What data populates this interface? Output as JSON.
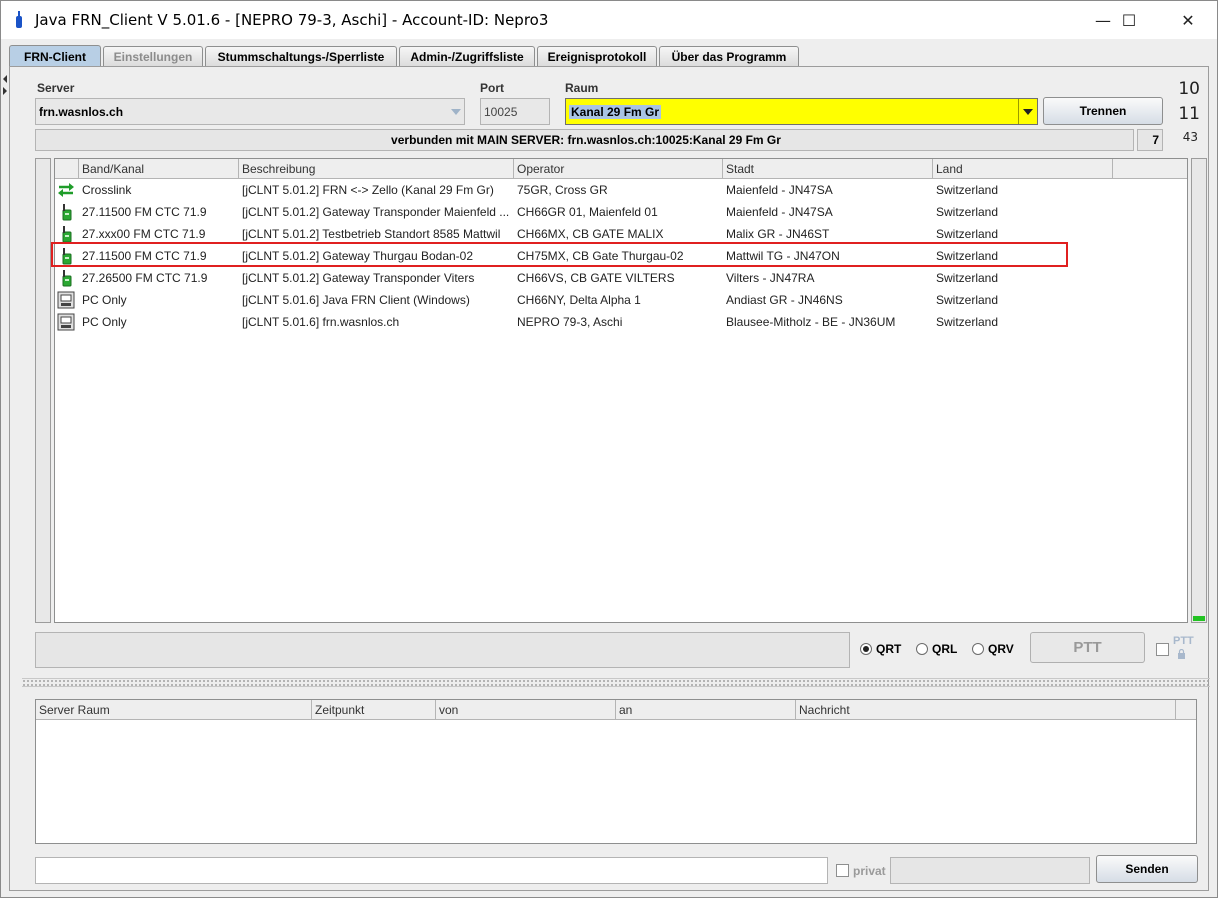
{
  "window": {
    "title": "Java FRN_Client V 5.01.6 - [NEPRO 79-3, Aschi] - Account-ID: Nepro3",
    "minimize": "—",
    "maximize": "☐",
    "close": "✕"
  },
  "tabs": [
    {
      "label": "FRN-Client"
    },
    {
      "label": "Einstellungen"
    },
    {
      "label": "Stummschaltungs-/Sperrliste"
    },
    {
      "label": "Admin-/Zugriffsliste"
    },
    {
      "label": "Ereignisprotokoll"
    },
    {
      "label": "Über das Programm"
    }
  ],
  "connection": {
    "server_label": "Server",
    "server_value": "frn.wasnlos.ch",
    "port_label": "Port",
    "port_value": "10025",
    "room_label": "Raum",
    "room_value": "Kanal 29 Fm Gr",
    "disconnect_label": "Trennen",
    "status": "verbunden mit  MAIN SERVER: frn.wasnlos.ch:10025:Kanal 29 Fm Gr",
    "status_count": "7",
    "counter_top": "10",
    "counter_mid": "11",
    "counter_small": "43"
  },
  "clients": {
    "columns": [
      "Band/Kanal",
      "Beschreibung",
      "Operator",
      "Stadt",
      "Land"
    ],
    "rows": [
      {
        "icon": "crosslink-icon",
        "band": "Crosslink",
        "desc": "[jCLNT 5.01.2] FRN <-> Zello (Kanal 29 Fm Gr)",
        "operator": "75GR, Cross GR",
        "city": "Maienfeld - JN47SA",
        "country": "Switzerland"
      },
      {
        "icon": "radio-icon",
        "band": "27.11500 FM CTC 71.9",
        "desc": "[jCLNT 5.01.2] Gateway Transponder Maienfeld ...",
        "operator": "CH66GR 01, Maienfeld 01",
        "city": "Maienfeld - JN47SA",
        "country": "Switzerland"
      },
      {
        "icon": "radio-icon",
        "band": "27.xxx00 FM CTC 71.9",
        "desc": "[jCLNT 5.01.2] Testbetrieb Standort  8585 Mattwil",
        "operator": "CH66MX, CB GATE MALIX",
        "city": "Malix GR - JN46ST",
        "country": "Switzerland"
      },
      {
        "icon": "radio-icon",
        "band": "27.11500 FM CTC 71.9",
        "desc": "[jCLNT 5.01.2] Gateway Thurgau Bodan-02",
        "operator": "CH75MX, CB Gate Thurgau-02",
        "city": "Mattwil TG - JN47ON",
        "country": "Switzerland"
      },
      {
        "icon": "radio-icon",
        "band": "27.26500 FM CTC 71.9",
        "desc": "[jCLNT 5.01.2] Gateway Transponder Viters",
        "operator": "CH66VS, CB GATE VILTERS",
        "city": "Vilters - JN47RA",
        "country": "Switzerland"
      },
      {
        "icon": "pc-icon",
        "band": "PC Only",
        "desc": "[jCLNT 5.01.6] Java FRN Client (Windows)",
        "operator": "CH66NY, Delta Alpha 1",
        "city": "Andiast GR - JN46NS",
        "country": "Switzerland"
      },
      {
        "icon": "pc-icon",
        "band": "PC Only",
        "desc": "[jCLNT 5.01.6] frn.wasnlos.ch",
        "operator": "NEPRO 79-3, Aschi",
        "city": "Blausee-Mitholz - BE - JN36UM",
        "country": "Switzerland"
      }
    ]
  },
  "controls": {
    "qrt": "QRT",
    "qrl": "QRL",
    "qrv": "QRV",
    "selected": "QRT",
    "ptt": "PTT",
    "ptt_lock": "PTT"
  },
  "messages": {
    "columns": [
      "Server Raum",
      "Zeitpunkt",
      "von",
      "an",
      "Nachricht"
    ],
    "privat_label": "privat",
    "send_label": "Senden"
  },
  "colors": {
    "room_bg": "#ffff00",
    "level_green": "#22c322",
    "highlight": "#e02020"
  }
}
